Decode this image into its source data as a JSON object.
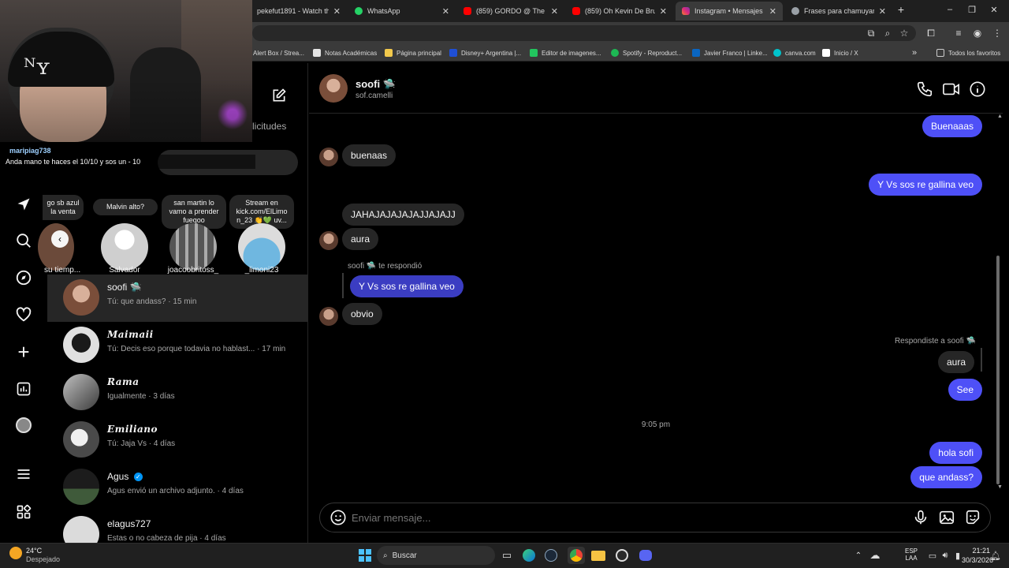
{
  "browser": {
    "tabs": [
      {
        "label": "pekefut1891 - Watch the",
        "color": "#53fc18"
      },
      {
        "label": "WhatsApp",
        "color": "#25d366"
      },
      {
        "label": "(859) GORDO @ The Vers",
        "color": "#ff0000"
      },
      {
        "label": "(859) Oh Kevin De Bruyne",
        "color": "#ff0000"
      },
      {
        "label": "Instagram • Mensajes",
        "color": "#e1306c"
      },
      {
        "label": "Frases para chamuyar",
        "color": "#9aa0a6"
      }
    ],
    "new_tab": "+",
    "window_controls": [
      "–",
      "❐",
      "✕"
    ],
    "bookmarks": [
      {
        "label": "Alert Box / Strea...",
        "color": "#f59e0b"
      },
      {
        "label": "Notas Académicas",
        "color": "#e5e5e5"
      },
      {
        "label": "Página principal",
        "color": "#f2c94c"
      },
      {
        "label": "Disney+ Argentina |...",
        "color": "#1f4fd6"
      },
      {
        "label": "Editor de imagenes...",
        "color": "#22c55e"
      },
      {
        "label": "Spotify - Reproduct...",
        "color": "#1db954"
      },
      {
        "label": "Javier Franco | Linke...",
        "color": "#0a66c2"
      },
      {
        "label": "canva.com",
        "color": "#00c4cc"
      },
      {
        "label": "Inicio / X",
        "color": "#ffffff"
      }
    ],
    "bookmarks_more": "»",
    "all_bookmarks": "Todos los favoritos"
  },
  "overlay": {
    "chat_user": "maripiag738",
    "chat_message": "Anda mano te haces el 10/10 y sos un - 10"
  },
  "sidebar": {
    "requests_label": "licitudes",
    "notes": [
      {
        "text": "go sb azul la venta"
      },
      {
        "text": "Malvin alto?"
      },
      {
        "text": "san martin lo vamo a prender fueqoo"
      },
      {
        "text": "Stream en kick.com/ElLimo n_23 👏💚 uv..."
      }
    ],
    "stories": [
      {
        "name": "su tiemp...",
        "color": "#6b4a3a"
      },
      {
        "name": "Salvador",
        "color": "#d9d9d9"
      },
      {
        "name": "joacoobritoss_",
        "color": "#8a8a8a"
      },
      {
        "name": "_limoni23",
        "color": "#6fb7e0"
      }
    ],
    "conversations": [
      {
        "name": "soofi 🛸",
        "subtitle": "Tú: que andass? · 15 min",
        "fancy": false,
        "active": true,
        "color": "#a0705a"
      },
      {
        "name": "Maimaii",
        "subtitle": "Tú: Decis eso porque todavia no hablast... · 17 min",
        "fancy": true,
        "active": false,
        "color": "#3a3a3a"
      },
      {
        "name": "Rama",
        "subtitle": "Igualmente · 3 días",
        "fancy": true,
        "active": false,
        "color": "#7a7a7a"
      },
      {
        "name": "Emiliano",
        "subtitle": "Tú: Jaja Vs · 4 días",
        "fancy": true,
        "active": false,
        "color": "#9a9a9a"
      },
      {
        "name": "Agus",
        "subtitle": "Agus envió un archivo adjunto. · 4 días",
        "fancy": false,
        "active": false,
        "color": "#4a5a4a",
        "verified": true
      },
      {
        "name": "elagus727",
        "subtitle": "Estas o no cabeza de pija · 4 días",
        "fancy": false,
        "active": false,
        "color": "#dbdbdb"
      }
    ]
  },
  "chat": {
    "name": "soofi 🛸",
    "username": "sof.camelli",
    "messages": {
      "m1": "Buenaaas",
      "m2": "buenaas",
      "m3": "Y Vs sos re gallina veo",
      "m4": "JAHAJAJAJAJAJJAJAJJ",
      "m5": "aura",
      "reply_label": "soofi 🛸 te respondió",
      "m6": "Y Vs sos re gallina veo",
      "m7": "obvio",
      "replied_label": "Respondiste a soofi 🛸",
      "m8": "aura",
      "m9": "See",
      "timestamp": "9:05 pm",
      "m10": "hola sofi",
      "m11": "que andass?"
    },
    "input_placeholder": "Enviar mensaje..."
  },
  "taskbar": {
    "weather_temp": "24°C",
    "weather_desc": "Despejado",
    "search_label": "Buscar",
    "lang_top": "ESP",
    "lang_bottom": "LAA",
    "time": "21:21",
    "date": "30/3/2026"
  },
  "colors": {
    "outgoing_bubble": "#4e50f7",
    "incoming_bubble": "#262626",
    "verified": "#0095f6"
  }
}
